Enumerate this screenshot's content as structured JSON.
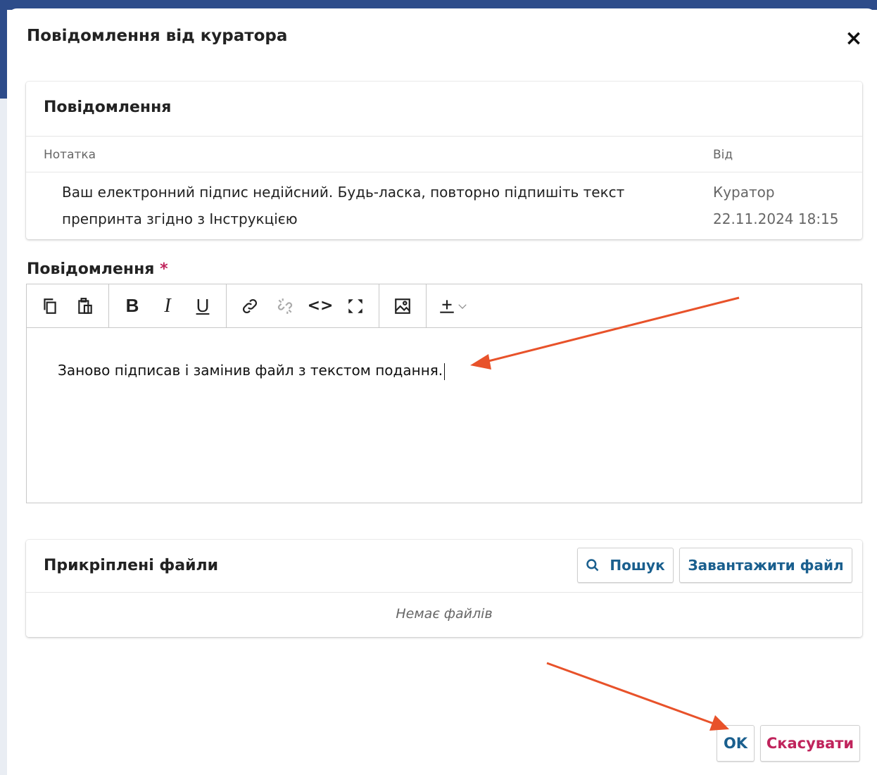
{
  "dialog": {
    "title": "Повідомлення від куратора",
    "close_symbol": "×"
  },
  "message_card": {
    "title": "Повідомлення",
    "columns": {
      "note": "Нотатка",
      "from": "Від"
    },
    "rows": [
      {
        "note": "Ваш електронний підпис недійсний. Будь-ласка, повторно підпишіть текст препринта згідно з Інструкцією",
        "author": "Куратор",
        "date": "22.11.2024 18:15"
      }
    ]
  },
  "reply": {
    "label": "Повідомлення",
    "required_mark": "*",
    "toolbar": [
      "copy-icon",
      "paste-icon",
      "bold-icon",
      "italic-icon",
      "underline-icon",
      "link-icon",
      "unlink-icon",
      "code-icon",
      "fullscreen-icon",
      "image-icon",
      "upload-icon",
      "chevron-down-icon"
    ],
    "toolbar_text": {
      "bold": "B",
      "italic": "I",
      "underline": "U",
      "code": "<>"
    },
    "text": "Заново підписав і замінив файл з текстом подання."
  },
  "attachments": {
    "title": "Прикріплені файли",
    "search_label": "Пошук",
    "upload_label": "Завантажити файл",
    "empty_text": "Немає файлів"
  },
  "footer": {
    "ok_label": "OK",
    "cancel_label": "Скасувати"
  },
  "colors": {
    "primary": "#1a5f8e",
    "accent": "#c0245c",
    "annotation_arrow": "#e8522a"
  }
}
